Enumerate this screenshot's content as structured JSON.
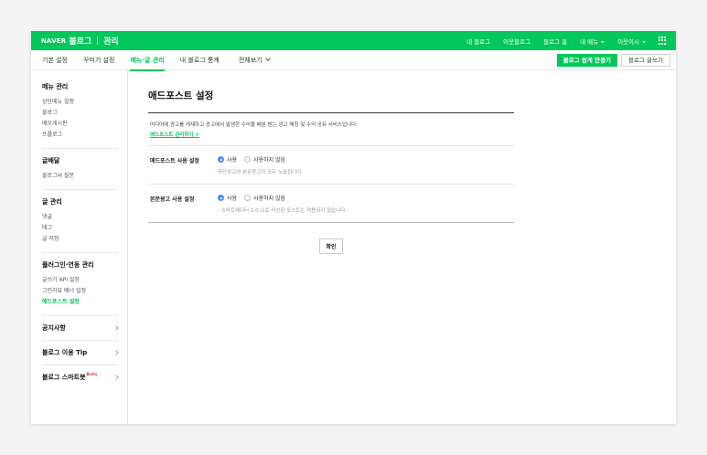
{
  "topbar": {
    "brand_naver": "NAVER",
    "brand_blog": "블로그",
    "brand_mgmt": "관리",
    "nav": [
      "내 블로그",
      "이웃블로그",
      "블로그 홈"
    ],
    "my_menu": "내 메뉴",
    "user": "이웃이시"
  },
  "subnav": {
    "tabs": [
      "기본 설정",
      "꾸미기 설정",
      "메뉴·글 관리",
      "내 블로그 통계"
    ],
    "active_tab": "메뉴·글 관리",
    "view_all": "전체보기",
    "easy_create": "블로그 쉽게 만들기",
    "write": "블로그 글쓰기"
  },
  "sidebar": {
    "menu_mgmt": {
      "title": "메뉴 관리",
      "items": [
        "상단메뉴 설정",
        "블로그",
        "메모게시판",
        "프롤로그"
      ]
    },
    "posting": {
      "title": "글배달",
      "items": [
        "블로그씨 질문"
      ]
    },
    "post_mgmt": {
      "title": "글 관리",
      "items": [
        "댓글",
        "태그",
        "글 저장"
      ]
    },
    "plugin": {
      "title": "플러그인·연동 관리",
      "items": [
        "글쓰기 API 설정",
        "그린리뷰 배너 설정",
        "애드포스트 설정"
      ],
      "active": "애드포스트 설정"
    },
    "notice": "공지사항",
    "tip": "블로그 이용 Tip",
    "smartbot": "블로그 스마트봇",
    "beta": "Beta"
  },
  "main": {
    "title": "애드포스트 설정",
    "desc": "미디어에 광고를 게재하고 광고에서 발생한 수익을 배분 받는 광고 매칭 및 수익 공유 서비스입니다.",
    "link": "애드포스트 관리하기",
    "link_arrow": ">",
    "settings": [
      {
        "label": "애드포스트 사용 설정",
        "on": "사용",
        "off": "사용하지 않음",
        "hint": "하단광고와 본문광고가 모두 노출됩니다."
      },
      {
        "label": "본문광고 사용 설정",
        "on": "사용",
        "off": "사용하지 않음",
        "hint": "- 스마트에디터 2.0 으로 작성된 포스트는 적용되지 않습니다."
      }
    ],
    "confirm": "확인"
  },
  "colors": {
    "brand": "#03c75a",
    "radio_on": "#4a8ef2",
    "beta": "#e63946"
  }
}
